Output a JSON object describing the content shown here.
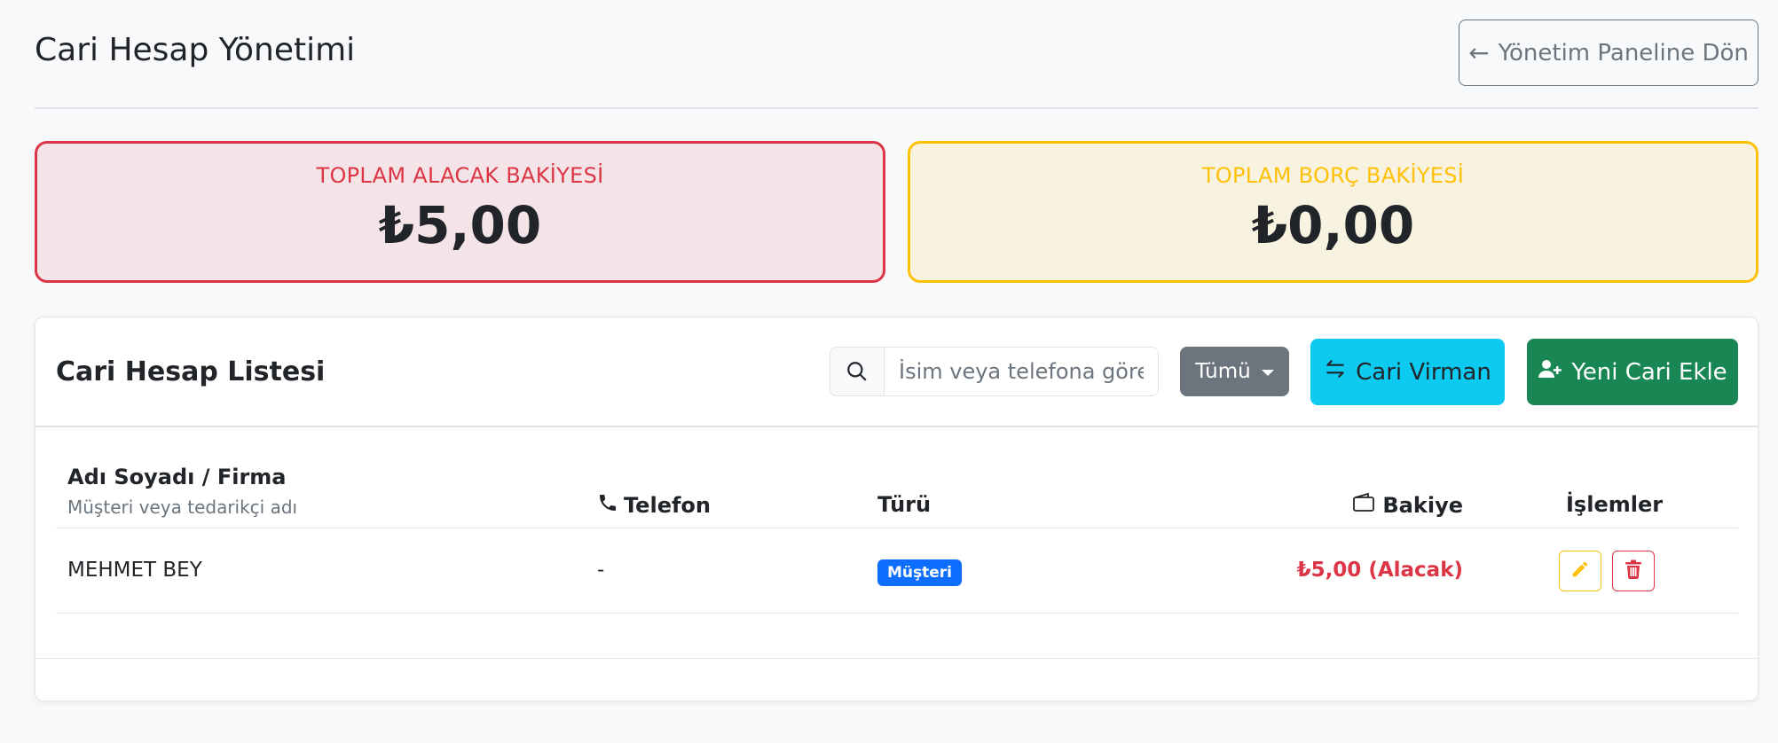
{
  "header": {
    "title": "Cari Hesap Yönetimi",
    "back_button": "Yönetim Paneline Dön"
  },
  "summary": {
    "receivable_label": "TOPLAM ALACAK BAKİYESİ",
    "receivable_amount": "₺5,00",
    "payable_label": "TOPLAM BORÇ BAKİYESİ",
    "payable_amount": "₺0,00"
  },
  "list": {
    "title": "Cari Hesap Listesi",
    "search_placeholder": "İsim veya telefona göre ara...",
    "filter_label": "Tümü",
    "transfer_button": "Cari Virman",
    "add_button": "Yeni Cari Ekle",
    "columns": {
      "name": "Adı Soyadı / Firma",
      "name_sub": "Müşteri veya tedarikçi adı",
      "phone": "Telefon",
      "type": "Türü",
      "balance": "Bakiye",
      "actions": "İşlemler"
    },
    "rows": [
      {
        "name": "MEHMET BEY",
        "phone": "-",
        "type": "Müşteri",
        "balance": "₺5,00 (Alacak)"
      }
    ]
  },
  "colors": {
    "danger": "#dc3545",
    "warning": "#ffc107",
    "info": "#0dcaf0",
    "success": "#198754",
    "primary": "#0d6efd",
    "secondary": "#6c757d"
  },
  "icons": [
    "arrow-left-icon",
    "search-icon",
    "transfer-icon",
    "add-user-icon",
    "phone-icon",
    "wallet-icon",
    "pencil-icon",
    "trash-icon"
  ]
}
